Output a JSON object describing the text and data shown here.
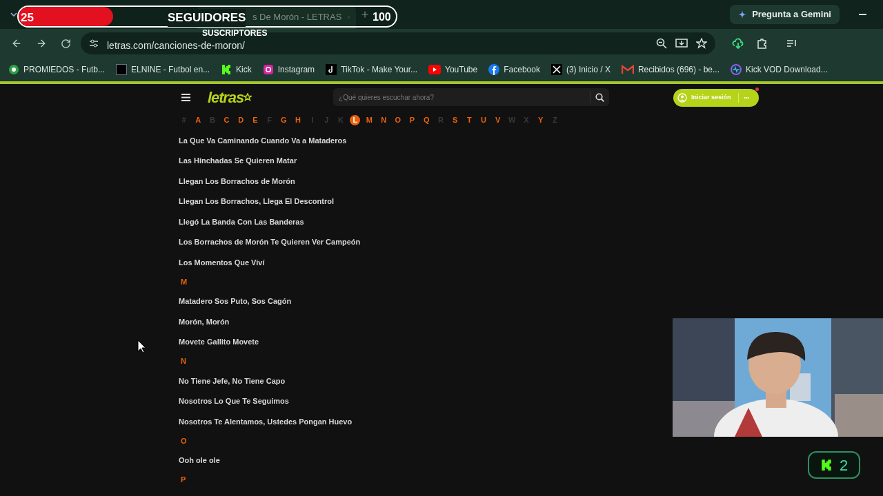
{
  "stream_overlay": {
    "start": "25",
    "label": "SEGUIDORES",
    "end": "100",
    "sublabel": "SUSCRIPTORES",
    "level": 0.25
  },
  "browser": {
    "tab_title": "s De Morón - LETRAS",
    "gemini": "Pregunta a Gemini",
    "url": "letras.com/canciones-de-moron/",
    "bookmarks": [
      {
        "kind": "ball",
        "label": "PROMIEDOS - Futb..."
      },
      {
        "kind": "no",
        "label": "ELNINE - Futbol en..."
      },
      {
        "kind": "kick",
        "label": "Kick"
      },
      {
        "kind": "instagram",
        "label": "Instagram"
      },
      {
        "kind": "tiktok",
        "label": "TikTok - Make Your..."
      },
      {
        "kind": "youtube",
        "label": "YouTube"
      },
      {
        "kind": "facebook",
        "label": "Facebook"
      },
      {
        "kind": "x",
        "label": "(3) Inicio / X"
      },
      {
        "kind": "gmail",
        "label": "Recibidos (696) - be..."
      },
      {
        "kind": "wave",
        "label": "Kick VOD Download..."
      }
    ]
  },
  "site": {
    "logo": "letras",
    "search_placeholder": "¿Qué quieres escuchar ahora?",
    "login": "Iniciar sesión",
    "more": "•••",
    "alphabet": [
      {
        "letter": "#",
        "enabled": false,
        "selected": false
      },
      {
        "letter": "A",
        "enabled": true,
        "selected": false
      },
      {
        "letter": "B",
        "enabled": false,
        "selected": false
      },
      {
        "letter": "C",
        "enabled": true,
        "selected": false
      },
      {
        "letter": "D",
        "enabled": true,
        "selected": false
      },
      {
        "letter": "E",
        "enabled": true,
        "selected": false
      },
      {
        "letter": "F",
        "enabled": false,
        "selected": false
      },
      {
        "letter": "G",
        "enabled": true,
        "selected": false
      },
      {
        "letter": "H",
        "enabled": true,
        "selected": false
      },
      {
        "letter": "I",
        "enabled": false,
        "selected": false
      },
      {
        "letter": "J",
        "enabled": false,
        "selected": false
      },
      {
        "letter": "K",
        "enabled": false,
        "selected": false
      },
      {
        "letter": "L",
        "enabled": true,
        "selected": true
      },
      {
        "letter": "M",
        "enabled": true,
        "selected": false
      },
      {
        "letter": "N",
        "enabled": true,
        "selected": false
      },
      {
        "letter": "O",
        "enabled": true,
        "selected": false
      },
      {
        "letter": "P",
        "enabled": true,
        "selected": false
      },
      {
        "letter": "Q",
        "enabled": true,
        "selected": false
      },
      {
        "letter": "R",
        "enabled": false,
        "selected": false
      },
      {
        "letter": "S",
        "enabled": true,
        "selected": false
      },
      {
        "letter": "T",
        "enabled": true,
        "selected": false
      },
      {
        "letter": "U",
        "enabled": true,
        "selected": false
      },
      {
        "letter": "V",
        "enabled": true,
        "selected": false
      },
      {
        "letter": "W",
        "enabled": false,
        "selected": false
      },
      {
        "letter": "X",
        "enabled": false,
        "selected": false
      },
      {
        "letter": "Y",
        "enabled": true,
        "selected": false
      },
      {
        "letter": "Z",
        "enabled": false,
        "selected": false
      }
    ],
    "songs": [
      {
        "kind": "song",
        "text": "La Que Va Caminando Cuando Va a Mataderos"
      },
      {
        "kind": "song",
        "text": "Las Hinchadas Se Quieren Matar"
      },
      {
        "kind": "song",
        "text": "Llegan Los Borrachos de Morón"
      },
      {
        "kind": "song",
        "text": "Llegan Los Borrachos, Llega El Descontrol"
      },
      {
        "kind": "song",
        "text": "Llegó La Banda Con Las Banderas"
      },
      {
        "kind": "song",
        "text": "Los Borrachos de Morón Te Quieren Ver Campeón"
      },
      {
        "kind": "song",
        "text": "Los Momentos Que Viví"
      },
      {
        "kind": "heading",
        "text": "M"
      },
      {
        "kind": "song",
        "text": "Matadero Sos Puto, Sos Cagón"
      },
      {
        "kind": "song",
        "text": "Morón, Morón"
      },
      {
        "kind": "song",
        "text": "Movete Gallito Movete"
      },
      {
        "kind": "heading",
        "text": "N"
      },
      {
        "kind": "song",
        "text": "No Tiene Jefe, No Tiene Capo"
      },
      {
        "kind": "song",
        "text": "Nosotros Lo Que Te Seguimos"
      },
      {
        "kind": "song",
        "text": "Nosotros Te Alentamos, Ustedes Pongan Huevo"
      },
      {
        "kind": "heading",
        "text": "O"
      },
      {
        "kind": "song",
        "text": "Ooh ole ole"
      },
      {
        "kind": "heading",
        "text": "P"
      }
    ]
  },
  "kick_badge": {
    "count": "2"
  }
}
